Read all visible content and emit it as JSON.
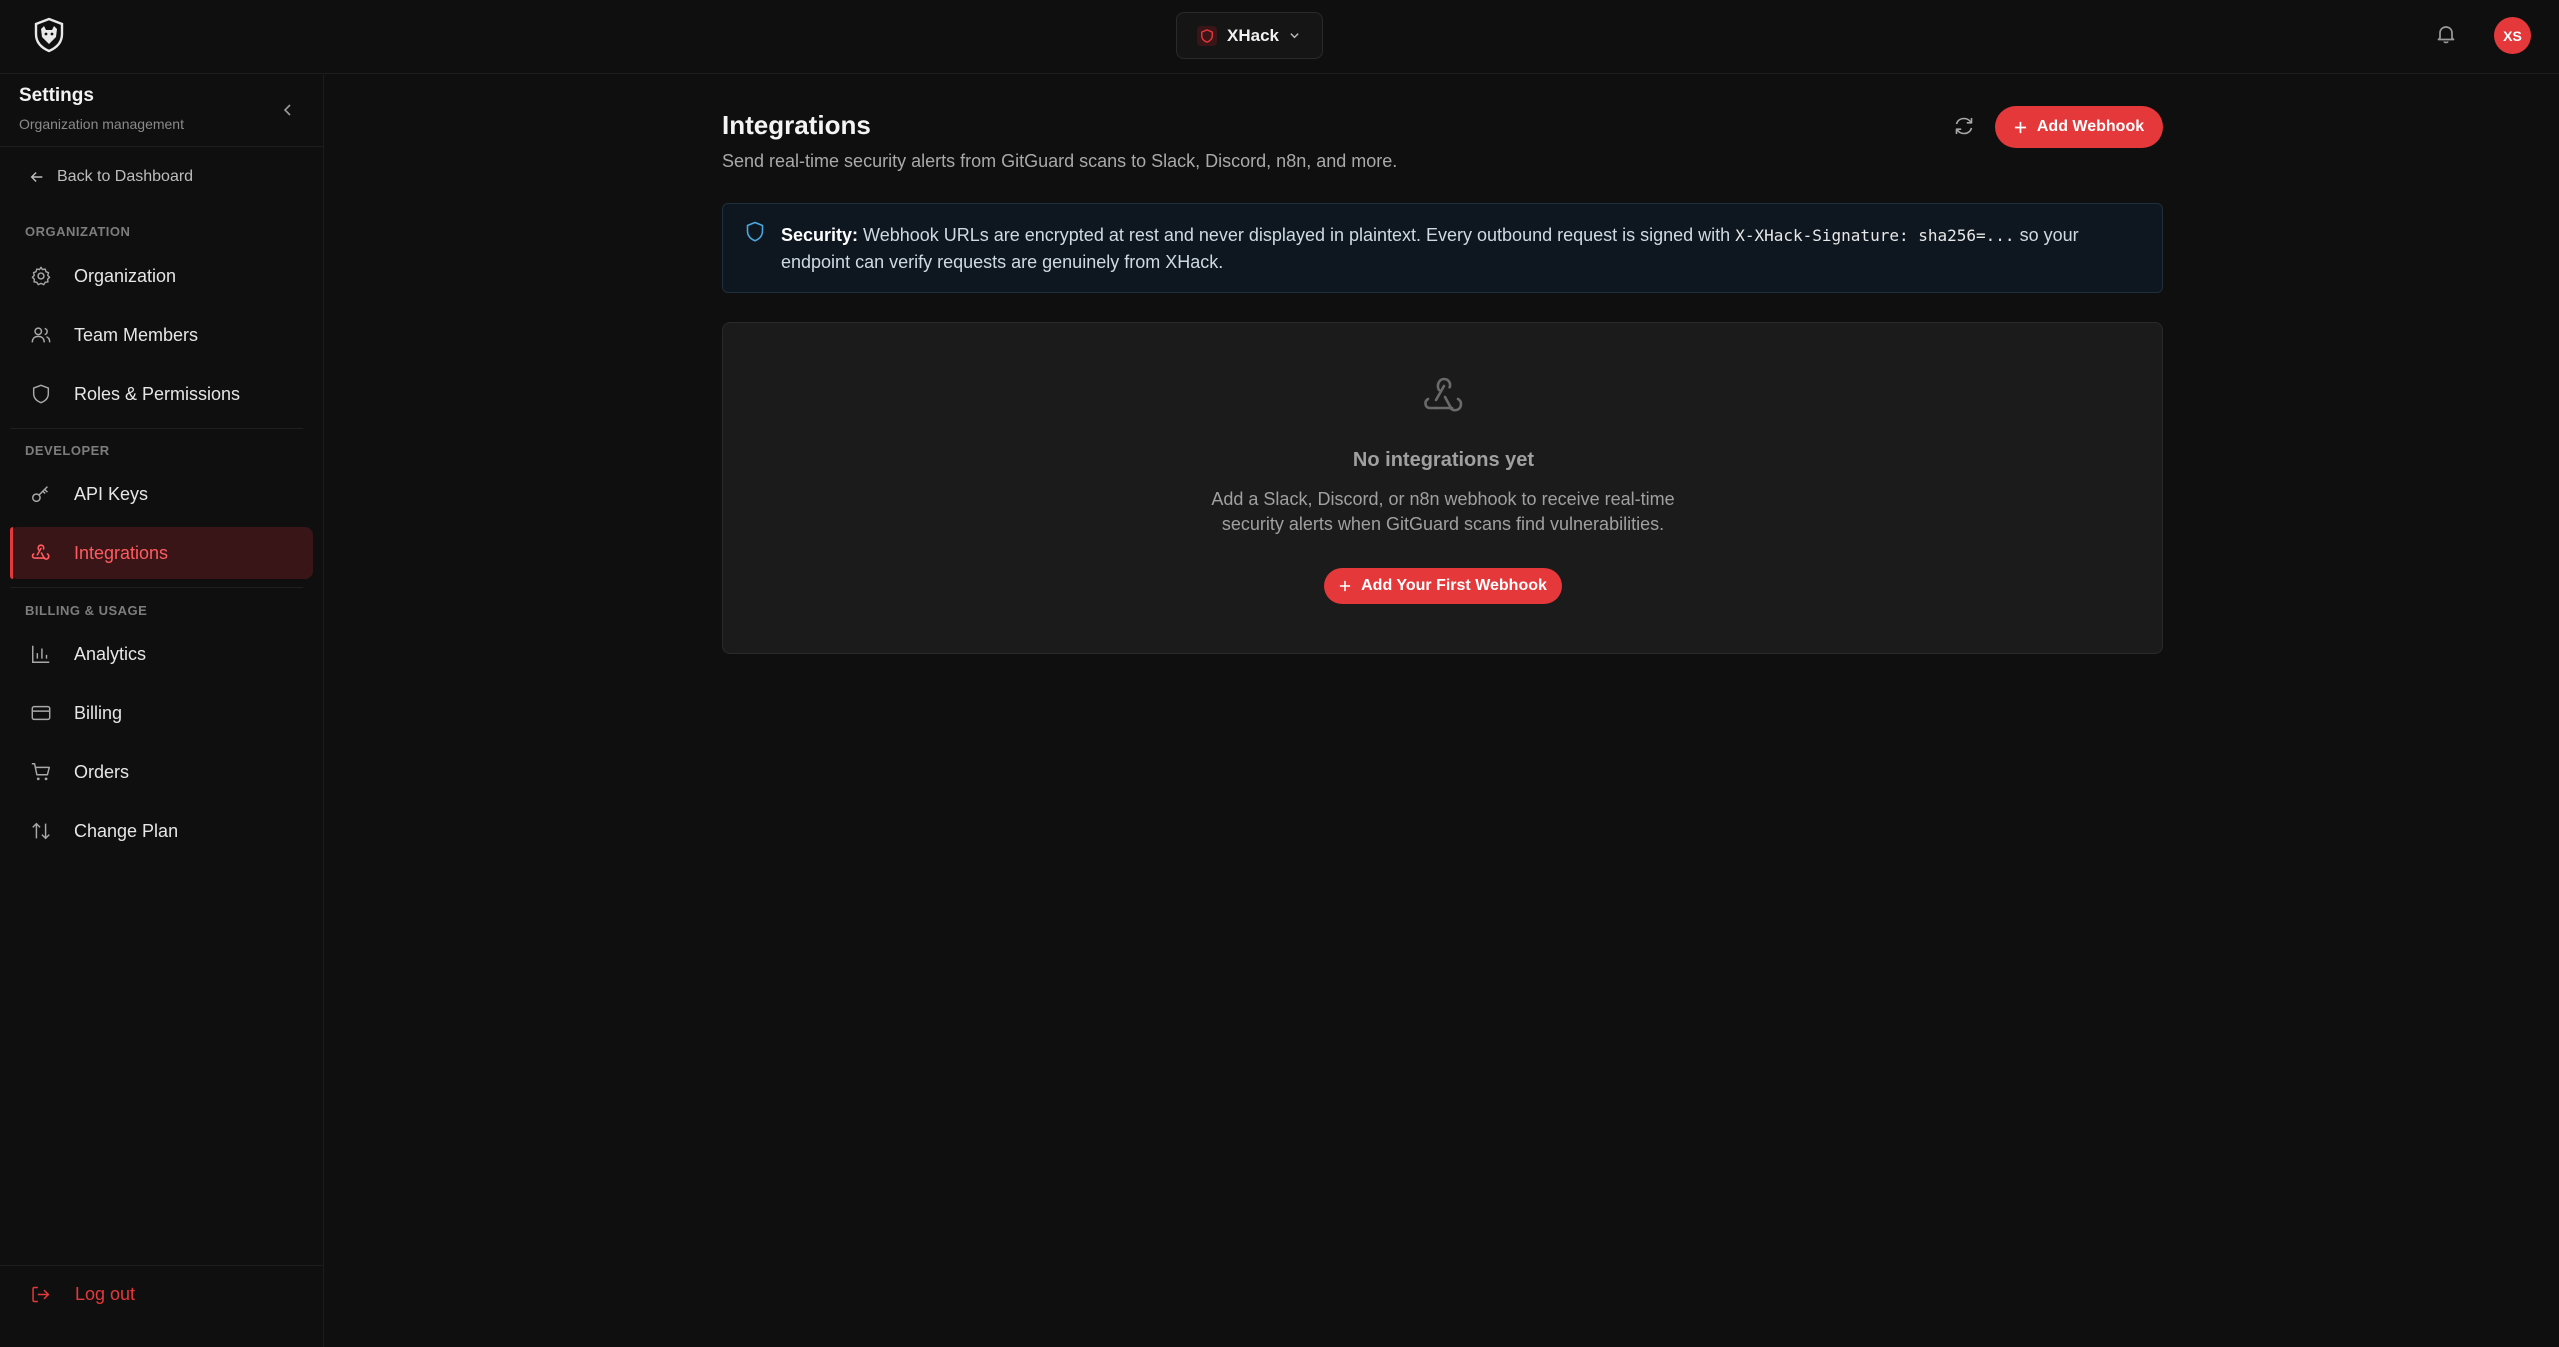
{
  "topbar": {
    "org_name": "XHack",
    "avatar_initials": "XS"
  },
  "sidebar": {
    "title": "Settings",
    "subtitle": "Organization management",
    "back_label": "Back to Dashboard",
    "sections": [
      {
        "label": "ORGANIZATION"
      },
      {
        "label": "DEVELOPER"
      },
      {
        "label": "BILLING & USAGE"
      }
    ],
    "items": [
      {
        "label": "Organization",
        "icon": "gear-icon"
      },
      {
        "label": "Team Members",
        "icon": "users-icon"
      },
      {
        "label": "Roles & Permissions",
        "icon": "shield-icon"
      },
      {
        "label": "API Keys",
        "icon": "key-icon"
      },
      {
        "label": "Integrations",
        "icon": "webhook-icon",
        "active": true
      },
      {
        "label": "Analytics",
        "icon": "bar-chart-icon"
      },
      {
        "label": "Billing",
        "icon": "credit-card-icon"
      },
      {
        "label": "Orders",
        "icon": "cart-icon"
      },
      {
        "label": "Change Plan",
        "icon": "arrows-up-down-icon"
      }
    ],
    "logout_label": "Log out"
  },
  "main": {
    "title": "Integrations",
    "description": "Send real-time security alerts from GitGuard scans to Slack, Discord, n8n, and more.",
    "add_webhook_label": "Add Webhook",
    "notice": {
      "bold": "Security:",
      "text_1": " Webhook URLs are encrypted at rest and never displayed in plaintext. Every outbound request is signed with ",
      "code": "X-XHack-Signature: sha256=...",
      "text_2": " so your endpoint can verify requests are genuinely from XHack."
    },
    "empty": {
      "title": "No integrations yet",
      "description": "Add a Slack, Discord, or n8n webhook to receive real-time security alerts when GitGuard scans find vulnerabilities.",
      "button_label": "Add Your First Webhook"
    }
  },
  "colors": {
    "accent": "#e5383b",
    "background": "#0f0f0f",
    "active_item_bg": "#3a1518",
    "notice_bg": "#0e1720"
  }
}
